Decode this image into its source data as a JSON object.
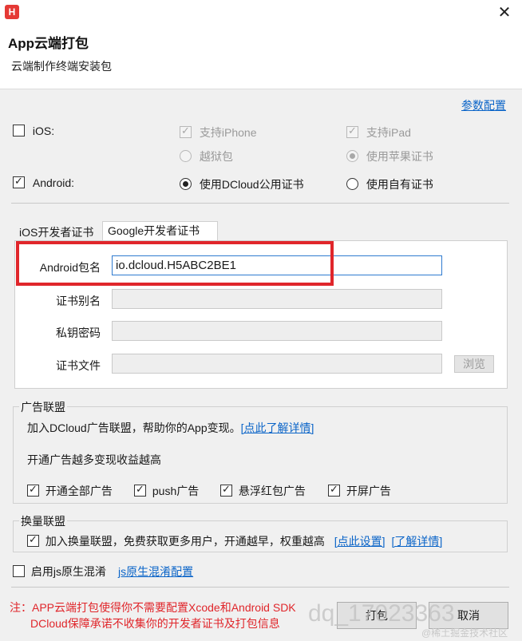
{
  "window": {
    "icon_text": "H",
    "title": "App云端打包",
    "subtitle": "云端制作终端安装包",
    "close_symbol": "✕"
  },
  "header_link": "参数配置",
  "platforms": {
    "ios": {
      "label": "iOS:",
      "checked": false
    },
    "iphone": {
      "label": "支持iPhone",
      "checked": true,
      "disabled": true
    },
    "ipad": {
      "label": "支持iPad",
      "checked": true,
      "disabled": true
    },
    "jailbreak": {
      "label": "越狱包",
      "selected": false,
      "disabled": true
    },
    "apple_cert": {
      "label": "使用苹果证书",
      "selected": true,
      "disabled": true
    },
    "android": {
      "label": "Android:",
      "checked": true
    },
    "dcloud_cert": {
      "label": "使用DCloud公用证书",
      "selected": true
    },
    "own_cert": {
      "label": "使用自有证书",
      "selected": false
    }
  },
  "tabs": [
    {
      "label": "iOS开发者证书",
      "active": false
    },
    {
      "label": "Google开发者证书",
      "active": true
    }
  ],
  "form": {
    "package_label": "Android包名",
    "package_value": "io.dcloud.H5ABC2BE1",
    "alias_label": "证书别名",
    "alias_value": "",
    "password_label": "私钥密码",
    "password_value": "",
    "file_label": "证书文件",
    "file_value": "",
    "browse_label": "浏览"
  },
  "ads": {
    "group_title": "广告联盟",
    "line1": "加入DCloud广告联盟，帮助你的App变现。",
    "line1_link": "[点此了解详情]",
    "line2": "开通广告越多变现收益越高",
    "options": [
      {
        "label": "开通全部广告",
        "checked": true
      },
      {
        "label": "push广告",
        "checked": true
      },
      {
        "label": "悬浮红包广告",
        "checked": true
      },
      {
        "label": "开屏广告",
        "checked": true
      }
    ]
  },
  "exchange": {
    "group_title": "换量联盟",
    "label": "加入换量联盟，免费获取更多用户，开通越早，权重越高",
    "checked": true,
    "link_settings": "[点此设置]",
    "link_details": "[了解详情]"
  },
  "obfuscation": {
    "label": "启用js原生混淆",
    "checked": false,
    "link": "js原生混淆配置"
  },
  "notice": {
    "line1": "注：APP云端打包使得你不需要配置Xcode和Android SDK",
    "line2": "DCloud保障承诺不收集你的开发者证书及打包信息"
  },
  "buttons": {
    "pack": "打包",
    "cancel": "取消"
  },
  "watermark": {
    "text": "dq_17023363",
    "site": "@稀土掘金技术社区"
  }
}
